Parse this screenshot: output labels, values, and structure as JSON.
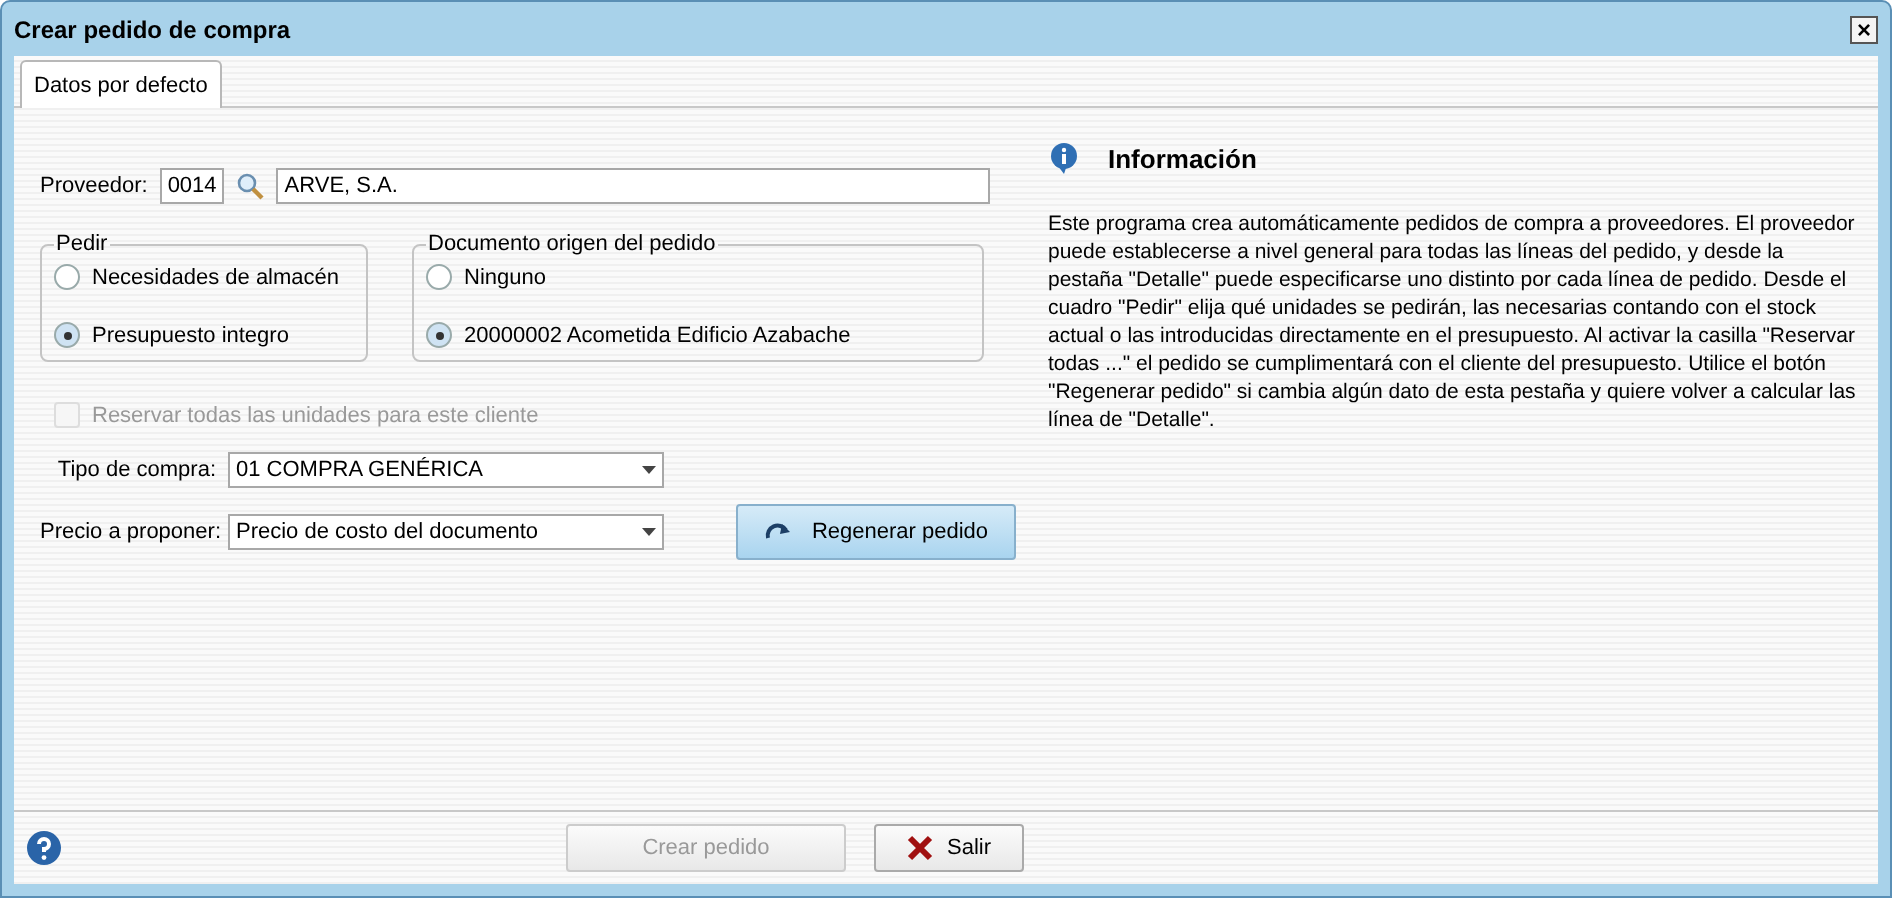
{
  "window": {
    "title": "Crear pedido de compra",
    "close_label": "×"
  },
  "tabs": [
    {
      "label": "Datos por defecto",
      "selected": true
    }
  ],
  "supplier": {
    "label": "Proveedor:",
    "code": "0014",
    "name": "ARVE, S.A."
  },
  "groups": [
    {
      "title": "Pedir",
      "options": [
        {
          "label": "Necesidades de almacén",
          "selected": false
        },
        {
          "label": "Presupuesto integro",
          "selected": true
        }
      ]
    },
    {
      "title": "Documento origen del pedido",
      "options": [
        {
          "label": "Ninguno",
          "selected": false
        },
        {
          "label": "20000002 Acometida Edificio Azabache",
          "selected": true
        }
      ]
    }
  ],
  "reserve": {
    "label": "Reservar todas las unidades para este cliente",
    "checked": false,
    "disabled": true
  },
  "selects": [
    {
      "label": "Tipo de compra:",
      "value": "01 COMPRA GENÉRICA"
    },
    {
      "label": "Precio a proponer:",
      "value": "Precio de costo del documento"
    }
  ],
  "regenerate_button": "Regenerar pedido",
  "info": {
    "title": "Información",
    "text": "Este programa crea automáticamente pedidos de compra a proveedores. El proveedor puede establecerse a nivel general para todas las líneas del pedido, y desde la pestaña \"Detalle\" puede especificarse uno distinto por cada línea de pedido. Desde el cuadro \"Pedir\" elija qué unidades se pedirán, las necesarias contando con el stock actual o las introducidas directamente en el presupuesto. Al activar la casilla \"Reservar todas ...\" el pedido se cumplimentará con el cliente del presupuesto. Utilice el botón \"Regenerar pedido\" si cambia algún dato de esta pestaña y quiere volver a calcular las línea de \"Detalle\"."
  },
  "buttons": [
    {
      "label": "Crear pedido",
      "disabled": true,
      "kind": "create"
    },
    {
      "label": "Salir",
      "disabled": false,
      "kind": "exit"
    }
  ]
}
